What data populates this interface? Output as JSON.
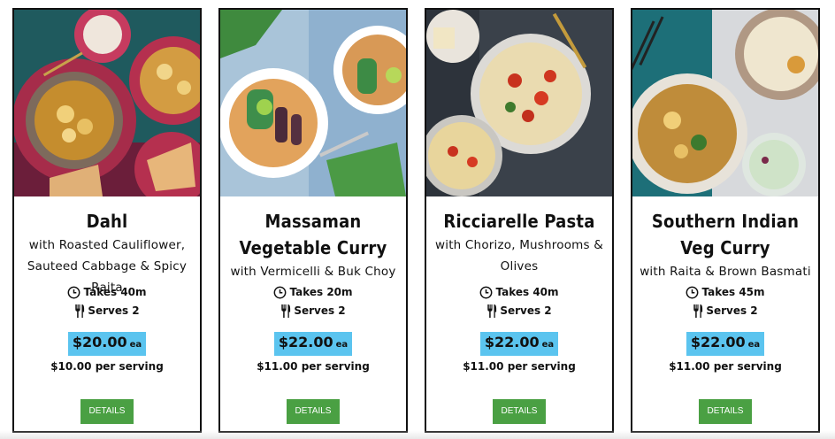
{
  "cards": [
    {
      "title": "Dahl",
      "subtitle": "with Roasted Cauliflower, Sauteed Cabbage & Spicy Raita",
      "time": "Takes 40m",
      "serves": "Serves 2",
      "price": "$20.00",
      "price_unit": "ea",
      "per_serving": "$10.00 per serving",
      "button": "DETAILS"
    },
    {
      "title": "Massaman Vegetable Curry",
      "subtitle": "with Vermicelli & Buk Choy",
      "time": "Takes 20m",
      "serves": "Serves 2",
      "price": "$22.00",
      "price_unit": "ea",
      "per_serving": "$11.00 per serving",
      "button": "DETAILS"
    },
    {
      "title": "Ricciarelle Pasta",
      "subtitle": "with Chorizo, Mushrooms & Olives",
      "time": "Takes 40m",
      "serves": "Serves 2",
      "price": "$22.00",
      "price_unit": "ea",
      "per_serving": "$11.00 per serving",
      "button": "DETAILS"
    },
    {
      "title": "Southern Indian Veg Curry",
      "subtitle": "with Raita & Brown Basmati",
      "time": "Takes 45m",
      "serves": "Serves 2",
      "price": "$22.00",
      "price_unit": "ea",
      "per_serving": "$11.00 per serving",
      "button": "DETAILS"
    }
  ],
  "colors": {
    "price_highlight": "#5bc4ef",
    "button": "#4aa043",
    "border": "#111111"
  }
}
